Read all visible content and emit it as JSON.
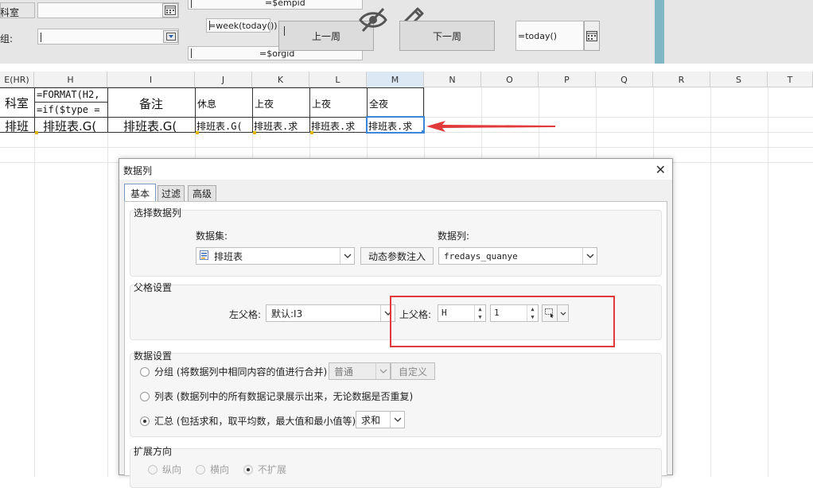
{
  "designer": {
    "label_office": "科室",
    "label_group": "组:",
    "empid_param": "=$empid",
    "week_param": "=week(today())",
    "orgid_param": "=$orgid",
    "prev_week_label": "上一周",
    "next_week_label": "下一周",
    "today_param": "=today()"
  },
  "sheet": {
    "columns": [
      "E(HR)",
      "H",
      "I",
      "J",
      "K",
      "L",
      "M",
      "N",
      "O",
      "P",
      "Q",
      "R",
      "S",
      "T"
    ],
    "selected_column": "M",
    "row1": {
      "e": "科室",
      "h_line1": "=FORMAT(H2,",
      "h_line2": "=if($type =",
      "i": "备注",
      "j": "休息",
      "k": "上夜",
      "l": "上夜",
      "m": "全夜"
    },
    "row2": {
      "e": "排班",
      "h": "排班表.G(",
      "i": "排班表.G(",
      "j": "排班表.G(",
      "k": "排班表.求",
      "l": "排班表.求",
      "m": "排班表.求"
    },
    "arrow_color": "#e03a3a"
  },
  "dialog": {
    "title": "数据列",
    "tabs": [
      "基本",
      "过滤",
      "高级"
    ],
    "active_tab": "基本",
    "select_group_title": "选择数据列",
    "dataset_label": "数据集:",
    "dataset_value": "排班表",
    "dynamic_param_button": "动态参数注入",
    "column_label": "数据列:",
    "column_value": "fredays_quanye",
    "parent_group_title": "父格设置",
    "left_parent_label": "左父格:",
    "left_parent_value": "默认:I3",
    "top_parent_label": "上父格:",
    "top_parent_col": "H",
    "top_parent_row": "1",
    "data_settings_title": "数据设置",
    "option_group": "分组 (将数据列中相同内容的值进行合并)",
    "group_mode_value": "普通",
    "custom_button": "自定义",
    "option_list": "列表 (数据列中的所有数据记录展示出来，无论数据是否重复)",
    "option_summary": "汇总 (包括求和，取平均数，最大值和最小值等)",
    "summary_value": "求和",
    "expand_group_title": "扩展方向",
    "expand_vertical": "纵向",
    "expand_horizontal": "横向",
    "expand_none": "不扩展",
    "highlight_color": "#e03a3a"
  }
}
